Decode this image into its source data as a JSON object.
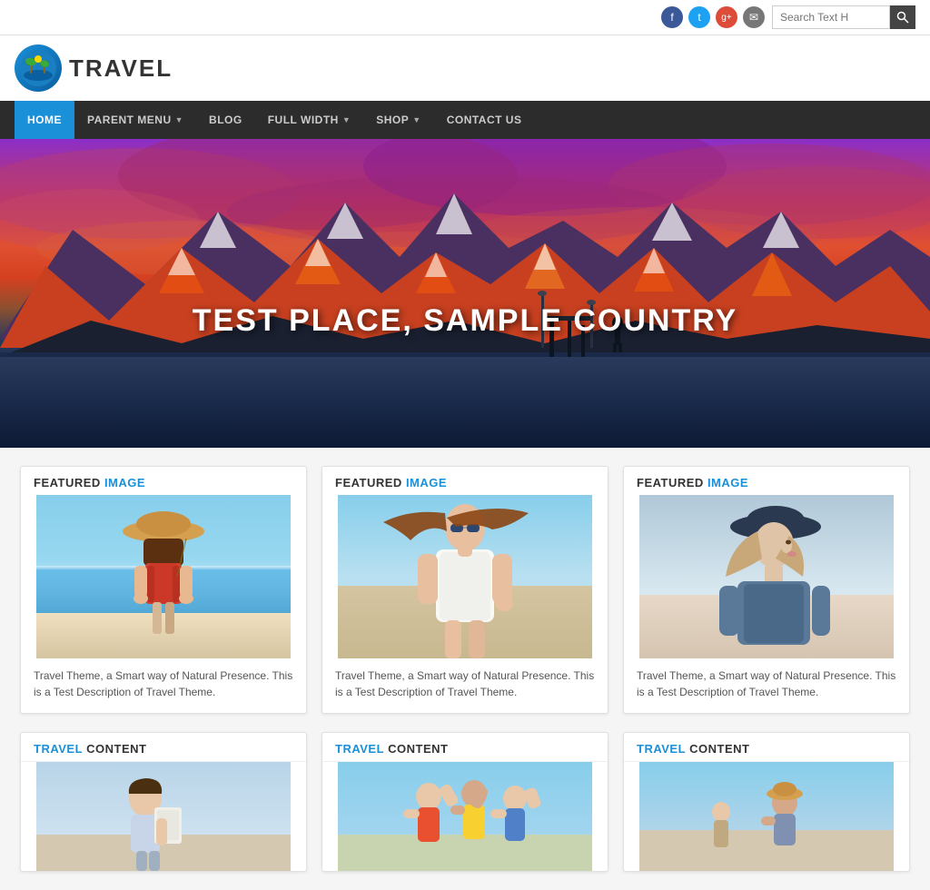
{
  "site": {
    "logo_text": "TRAVEL",
    "tagline": "TEST PLACE, SAMPLE COUNTRY"
  },
  "topbar": {
    "search_placeholder": "Search Text H",
    "social": {
      "facebook": "f",
      "twitter": "t",
      "google": "g+",
      "email": "✉"
    }
  },
  "nav": {
    "items": [
      {
        "label": "HOME",
        "active": true,
        "has_arrow": false
      },
      {
        "label": "PARENT MENU",
        "active": false,
        "has_arrow": true
      },
      {
        "label": "BLOG",
        "active": false,
        "has_arrow": false
      },
      {
        "label": "FULL WIDTH",
        "active": false,
        "has_arrow": true
      },
      {
        "label": "SHOP",
        "active": false,
        "has_arrow": true
      },
      {
        "label": "CONTACT US",
        "active": false,
        "has_arrow": false
      }
    ]
  },
  "hero": {
    "title": "TEST PLACE, SAMPLE COUNTRY"
  },
  "featured_cards": [
    {
      "label": "FEATURED",
      "label_highlight": "IMAGE",
      "description": "Travel Theme, a Smart way of Natural Presence. This is a Test Description of Travel Theme."
    },
    {
      "label": "FEATURED",
      "label_highlight": "IMAGE",
      "description": "Travel Theme, a Smart way of Natural Presence. This is a Test Description of Travel Theme."
    },
    {
      "label": "FEATURED",
      "label_highlight": "IMAGE",
      "description": "Travel Theme, a Smart way of Natural Presence. This is a Test Description of Travel Theme."
    }
  ],
  "travel_cards": [
    {
      "label": "TRAVEL",
      "label_highlight": "TRAVEL",
      "section_text": "CONTENT"
    },
    {
      "label": "TRAVEL",
      "label_highlight": "TRAVEL",
      "section_text": "CONTENT"
    },
    {
      "label": "TRAVEL",
      "label_highlight": "TRAVEL",
      "section_text": "CONTENT"
    }
  ]
}
